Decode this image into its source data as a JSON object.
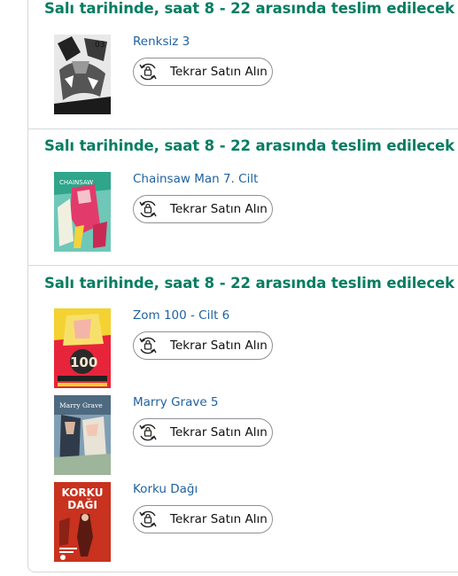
{
  "groups": [
    {
      "heading": "Salı tarihinde, saat 8 - 22 arasında teslim edilecek",
      "items": [
        {
          "title": "Renksiz 3",
          "button": "Tekrar Satın Alın"
        }
      ]
    },
    {
      "heading": "Salı tarihinde, saat 8 - 22 arasında teslim edilecek",
      "items": [
        {
          "title": "Chainsaw Man 7. Cilt",
          "button": "Tekrar Satın Alın"
        }
      ]
    },
    {
      "heading": "Salı tarihinde, saat 8 - 22 arasında teslim edilecek",
      "items": [
        {
          "title": "Zom 100 - Cilt 6",
          "button": "Tekrar Satın Alın"
        },
        {
          "title": "Marry Grave 5",
          "button": "Tekrar Satın Alın"
        },
        {
          "title": "Korku Dağı",
          "button": "Tekrar Satın Alın",
          "cover_text": [
            "KORKU",
            "DAĞI"
          ]
        }
      ]
    }
  ],
  "colors": {
    "heading": "#067d62",
    "link": "#2162a1",
    "border": "#d5d9d9"
  }
}
